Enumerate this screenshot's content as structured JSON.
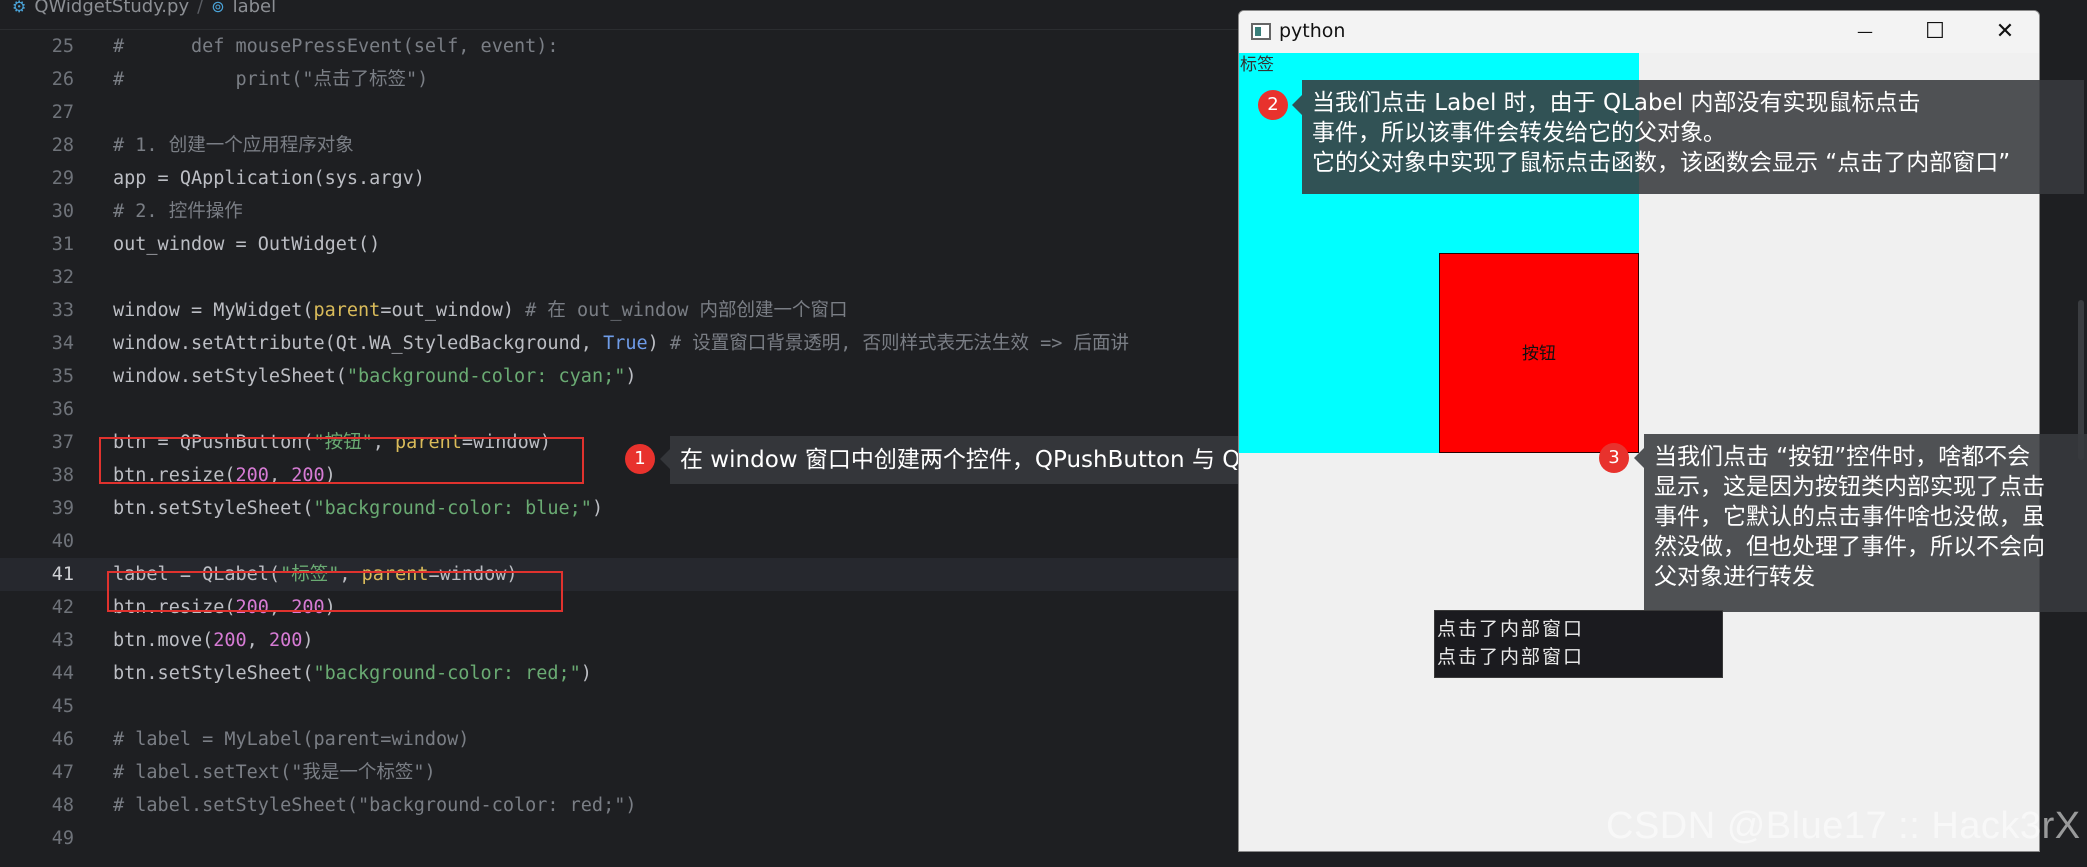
{
  "breadcrumb": {
    "file": "QWidgetStudy.py",
    "separator": "/",
    "symbol": "label"
  },
  "code_lines": [
    {
      "n": "25",
      "parts": [
        {
          "t": "cm",
          "v": "#      def mousePressEvent(self, event):"
        }
      ]
    },
    {
      "n": "26",
      "parts": [
        {
          "t": "cm",
          "v": "#          print(\"点击了标签\")"
        }
      ]
    },
    {
      "n": "27",
      "parts": []
    },
    {
      "n": "28",
      "parts": [
        {
          "t": "cm",
          "v": "# 1. 创建一个应用程序对象"
        }
      ]
    },
    {
      "n": "29",
      "parts": [
        {
          "t": "",
          "v": "app = QApplication(sys.argv)"
        }
      ]
    },
    {
      "n": "30",
      "parts": [
        {
          "t": "cm",
          "v": "# 2. 控件操作"
        }
      ]
    },
    {
      "n": "31",
      "parts": [
        {
          "t": "",
          "v": "out_window = OutWidget()"
        }
      ]
    },
    {
      "n": "32",
      "parts": []
    },
    {
      "n": "33",
      "parts": [
        {
          "t": "",
          "v": "window = MyWidget("
        },
        {
          "t": "kwarg",
          "v": "parent"
        },
        {
          "t": "",
          "v": "=out_window) "
        },
        {
          "t": "cm",
          "v": "# 在 out_window 内部创建一个窗口"
        }
      ]
    },
    {
      "n": "34",
      "parts": [
        {
          "t": "",
          "v": "window.setAttribute(Qt.WA_StyledBackground, "
        },
        {
          "t": "kw",
          "v": "True"
        },
        {
          "t": "",
          "v": ") "
        },
        {
          "t": "cm",
          "v": "# 设置窗口背景透明, 否则样式表无法生效 => 后面讲"
        }
      ]
    },
    {
      "n": "35",
      "parts": [
        {
          "t": "",
          "v": "window.setStyleSheet("
        },
        {
          "t": "str",
          "v": "\"background-color: cyan;\""
        },
        {
          "t": "",
          "v": ")"
        }
      ]
    },
    {
      "n": "36",
      "parts": []
    },
    {
      "n": "37",
      "parts": [
        {
          "t": "",
          "v": "btn = QPushButton("
        },
        {
          "t": "str",
          "v": "\"按钮\""
        },
        {
          "t": "",
          "v": ", "
        },
        {
          "t": "kwarg",
          "v": "parent"
        },
        {
          "t": "",
          "v": "=window)"
        }
      ]
    },
    {
      "n": "38",
      "parts": [
        {
          "t": "",
          "v": "btn.resize("
        },
        {
          "t": "num",
          "v": "200"
        },
        {
          "t": "",
          "v": ", "
        },
        {
          "t": "num",
          "v": "200"
        },
        {
          "t": "",
          "v": ")"
        }
      ]
    },
    {
      "n": "39",
      "parts": [
        {
          "t": "",
          "v": "btn.setStyleSheet("
        },
        {
          "t": "str",
          "v": "\"background-color: blue;\""
        },
        {
          "t": "",
          "v": ")"
        }
      ]
    },
    {
      "n": "40",
      "parts": []
    },
    {
      "n": "41",
      "parts": [
        {
          "t": "",
          "v": "label = QLabel("
        },
        {
          "t": "str",
          "v": "\"标签\""
        },
        {
          "t": "",
          "v": ", "
        },
        {
          "t": "kwarg",
          "v": "parent"
        },
        {
          "t": "",
          "v": "=window)"
        }
      ]
    },
    {
      "n": "42",
      "parts": [
        {
          "t": "",
          "v": "btn.resize("
        },
        {
          "t": "num",
          "v": "200"
        },
        {
          "t": "",
          "v": ", "
        },
        {
          "t": "num",
          "v": "200"
        },
        {
          "t": "",
          "v": ")"
        }
      ]
    },
    {
      "n": "43",
      "parts": [
        {
          "t": "",
          "v": "btn.move("
        },
        {
          "t": "num",
          "v": "200"
        },
        {
          "t": "",
          "v": ", "
        },
        {
          "t": "num",
          "v": "200"
        },
        {
          "t": "",
          "v": ")"
        }
      ]
    },
    {
      "n": "44",
      "parts": [
        {
          "t": "",
          "v": "btn.setStyleSheet("
        },
        {
          "t": "str",
          "v": "\"background-color: red;\""
        },
        {
          "t": "",
          "v": ")"
        }
      ]
    },
    {
      "n": "45",
      "parts": []
    },
    {
      "n": "46",
      "parts": [
        {
          "t": "cm",
          "v": "# label = MyLabel(parent=window)"
        }
      ]
    },
    {
      "n": "47",
      "parts": [
        {
          "t": "cm",
          "v": "# label.setText(\"我是一个标签\")"
        }
      ]
    },
    {
      "n": "48",
      "parts": [
        {
          "t": "cm",
          "v": "# label.setStyleSheet(\"background-color: red;\")"
        }
      ]
    },
    {
      "n": "49",
      "parts": []
    }
  ],
  "current_line": "41",
  "annotations": {
    "a1": {
      "badge": "1",
      "text": "在 window 窗口中创建两个控件，QPushButton 与 QLabel"
    },
    "a2": {
      "badge": "2",
      "lines": [
        "当我们点击 Label 时，由于 QLabel 内部没有实现鼠标点击",
        "事件，所以该事件会转发给它的父对象。",
        "它的父对象中实现了鼠标点击函数，该函数会显示 “点击了内部窗口”"
      ]
    },
    "a3": {
      "badge": "3",
      "lines": [
        "当我们点击 “按钮”控件时，啥都不会",
        "显示，这是因为按钮类内部实现了点击",
        "事件，它默认的点击事件啥也没做，虽",
        "然没做，但也处理了事件，所以不会向",
        "父对象进行转发"
      ]
    }
  },
  "pywindow": {
    "title": "python",
    "minimize_glyph": "—",
    "maximize_glyph": "☐",
    "close_glyph": "✕",
    "label_text": "标签",
    "button_text": "按钮",
    "colors": {
      "window_bg": "#00ffff",
      "button_bg": "#ff0000"
    }
  },
  "console": {
    "lines": [
      "点击了内部窗口",
      "点击了内部窗口"
    ]
  },
  "watermark": "CSDN @Blue17 :: Hack3rX"
}
